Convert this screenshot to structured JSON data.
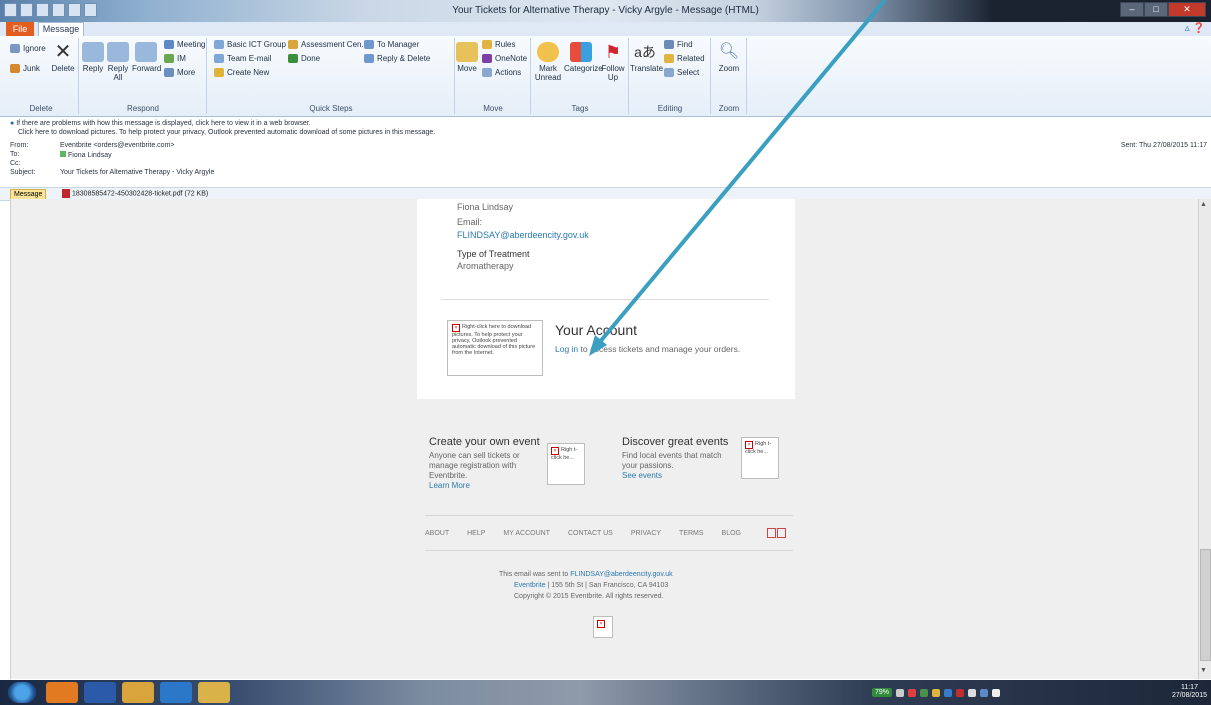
{
  "window": {
    "title": "Your Tickets for Alternative Therapy - Vicky Argyle - Message (HTML)"
  },
  "tabs": {
    "file": "File",
    "message": "Message"
  },
  "ribbon": {
    "delete_group": {
      "ignore": "Ignore",
      "junk": "Junk",
      "delete": "Delete",
      "label": "Delete"
    },
    "respond_group": {
      "reply": "Reply",
      "reply_all": "Reply All",
      "forward": "Forward",
      "meeting": "Meeting",
      "im": "IM",
      "more": "More",
      "label": "Respond"
    },
    "quick_steps": {
      "basic_ict": "Basic ICT Group",
      "team_email": "Team E-mail",
      "create_new": "Create New",
      "assessment": "Assessment Cen...",
      "done": "Done",
      "to_manager": "To Manager",
      "reply_delete": "Reply & Delete",
      "label": "Quick Steps"
    },
    "move_group": {
      "move": "Move",
      "rules": "Rules",
      "onenote": "OneNote",
      "actions": "Actions",
      "label": "Move"
    },
    "tags_group": {
      "mark_unread": "Mark Unread",
      "categorize": "Categorize",
      "follow_up": "Follow Up",
      "label": "Tags"
    },
    "editing_group": {
      "translate": "Translate",
      "find": "Find",
      "related": "Related",
      "select": "Select",
      "label": "Editing"
    },
    "zoom_group": {
      "zoom": "Zoom",
      "label": "Zoom"
    }
  },
  "header": {
    "info_line1": "If there are problems with how this message is displayed, click here to view it in a web browser.",
    "info_line2": "Click here to download pictures. To help protect your privacy, Outlook prevented automatic download of some pictures in this message.",
    "from_label": "From:",
    "from_value": "Eventbrite <orders@eventbrite.com>",
    "to_label": "To:",
    "to_value": "Fiona Lindsay",
    "cc_label": "Cc:",
    "subject_label": "Subject:",
    "subject_value": "Your Tickets for Alternative Therapy - Vicky Argyle",
    "sent": "Sent:  Thu 27/08/2015 11:17",
    "message_tab": "Message",
    "attachment": "18308585472-450302428-ticket.pdf (72 KB)"
  },
  "email": {
    "name": "Fiona Lindsay",
    "email_label": "Email:",
    "email_value": "FLINDSAY@aberdeencity.gov.uk",
    "treatment_label": "Type of Treatment",
    "treatment_value": "Aromatherapy",
    "blocked_image_text": "Right-click here to download pictures. To help protect your privacy, Outlook prevented automatic download of this picture from the Internet.",
    "account_title": "Your Account",
    "login_link": "Log in",
    "login_rest": " to access tickets and manage your orders.",
    "create_title": "Create your own event",
    "create_text1": "Anyone can sell tickets or",
    "create_text2": "manage registration with",
    "create_text3": "Eventbrite.",
    "learn_more": "Learn More",
    "discover_title": "Discover great events",
    "discover_text1": "Find local events that match",
    "discover_text2": "your passions.",
    "see_events": "See events",
    "small_blocked": "Righ t- click he...",
    "footer_links": [
      "ABOUT",
      "HELP",
      "MY ACCOUNT",
      "CONTACT US",
      "PRIVACY",
      "TERMS",
      "BLOG"
    ],
    "sent_to_prefix": "This email was sent to ",
    "sent_to_email": "FLINDSAY@aberdeencity.gov.uk",
    "address_brand": "Eventbrite",
    "address_rest": " | 155 5th St | San Francisco, CA 94103",
    "copyright": "Copyright © 2015 Eventbrite. All rights reserved."
  },
  "taskbar": {
    "battery": "79%",
    "time": "11:17",
    "date": "27/08/2015"
  },
  "colors": {
    "link": "#2a7ab0",
    "arrow": "#3a9fc0",
    "file_tab": "#e35d1f"
  }
}
